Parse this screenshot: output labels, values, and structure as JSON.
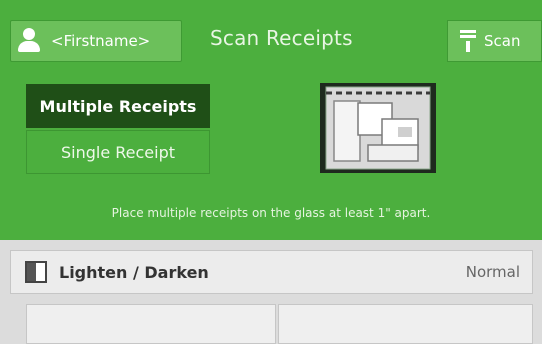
{
  "header": {
    "user_label": "<Firstname>",
    "app_title": "Scan Receipts",
    "scan_label": "Scan"
  },
  "mode_tabs": {
    "multiple_label": "Multiple Receipts",
    "single_label": "Single Receipt",
    "selected": "Multiple Receipts"
  },
  "hint_text": "Place multiple receipts on the glass at least 1\" apart.",
  "settings": {
    "lighten_darken_label": "Lighten / Darken",
    "lighten_darken_value": "Normal"
  },
  "colors": {
    "header_green": "#4caf3e",
    "selected_tab": "#1f4f17",
    "button_green": "#6cc05b"
  },
  "icons": {
    "user": "user-icon",
    "scan": "scan-icon",
    "lighten_darken": "contrast-icon",
    "illustration": "scanner-glass-illustration"
  }
}
